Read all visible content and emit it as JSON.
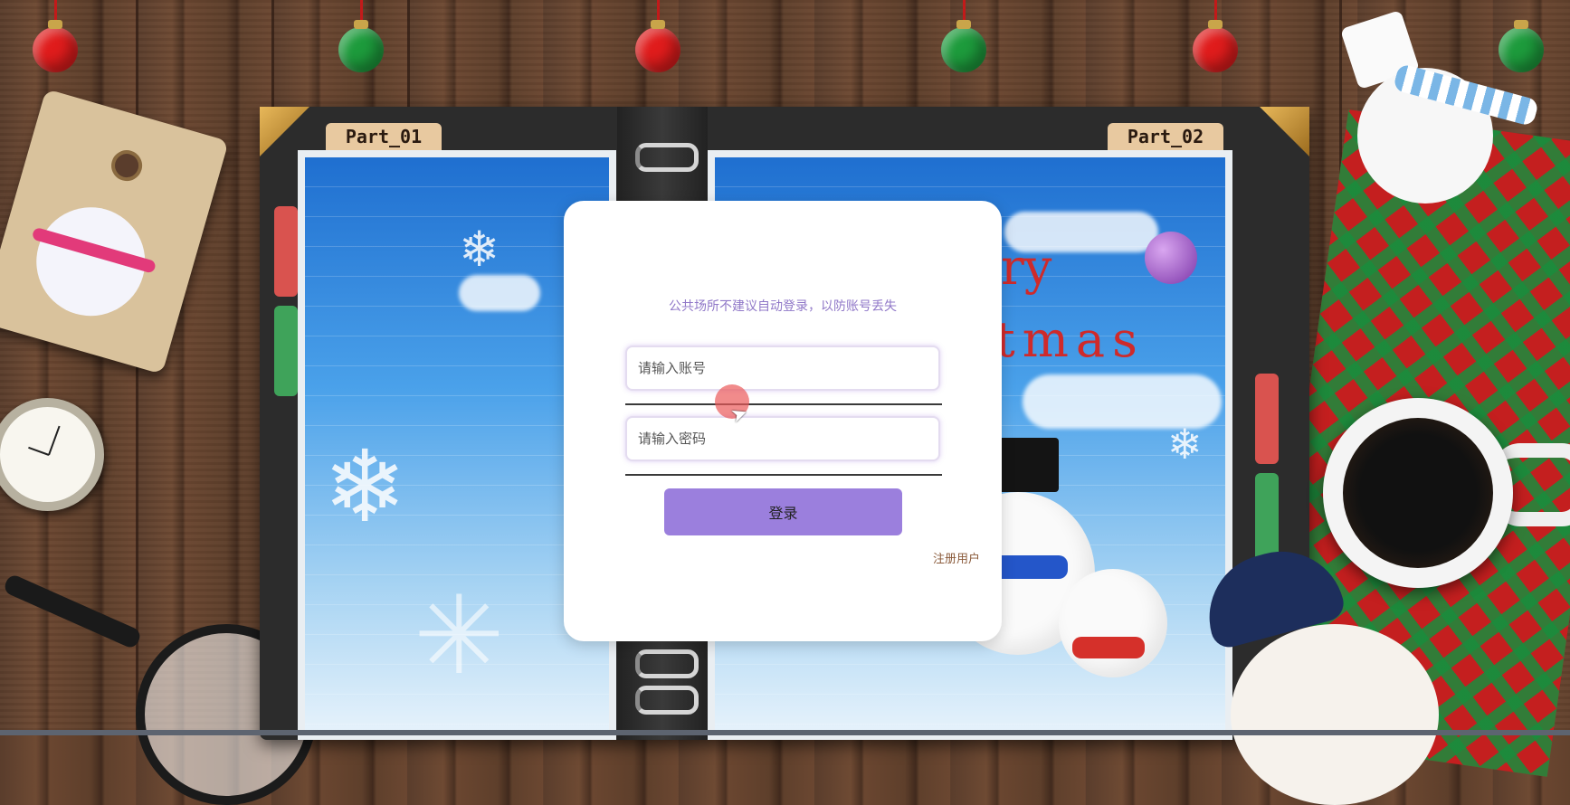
{
  "planner": {
    "left_tab": "Part_01",
    "right_tab": "Part_02",
    "greeting_fragment_1": "ry",
    "greeting_fragment_2": "tmas"
  },
  "login": {
    "notice": "公共场所不建议自动登录，以防账号丢失",
    "account_placeholder": "请输入账号",
    "password_placeholder": "请输入密码",
    "login_label": "登录",
    "register_label": "注册用户"
  },
  "colors": {
    "accent": "#9b7fdd",
    "notice_text": "#9078c8",
    "register_link": "#8a5a3a"
  },
  "icons": {
    "cursor": "mouse-pointer-icon"
  }
}
